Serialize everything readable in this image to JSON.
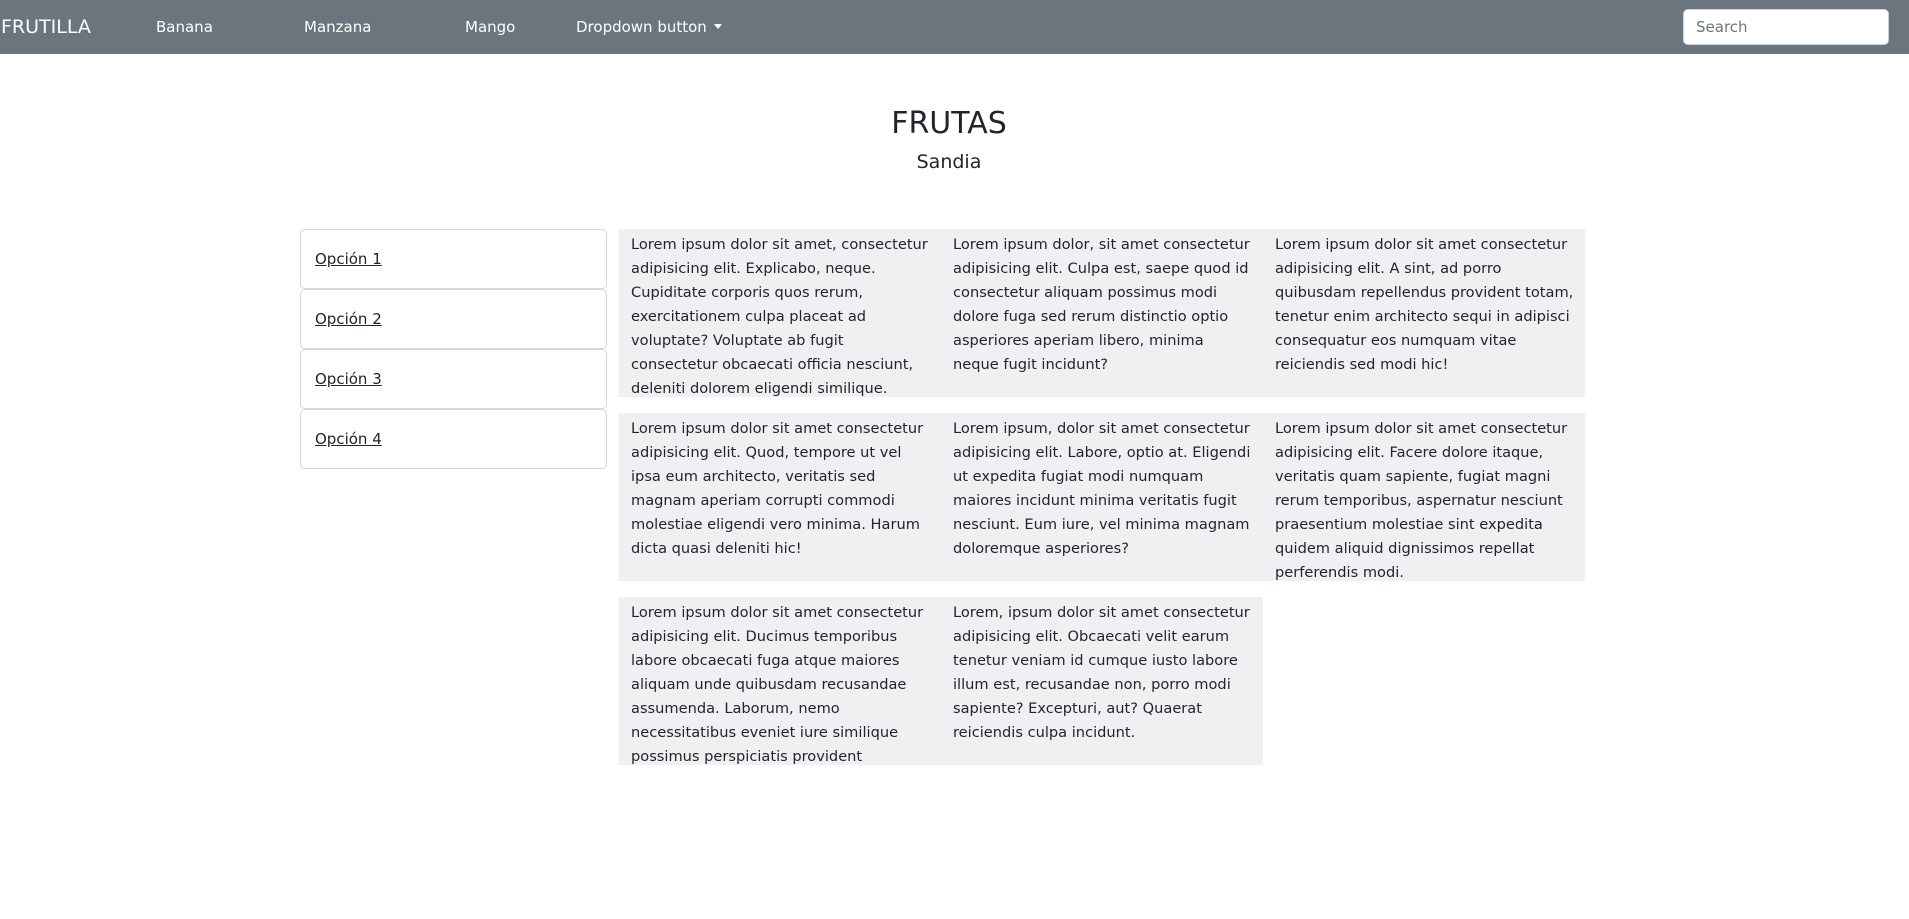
{
  "navbar": {
    "brand": "FRUTILLA",
    "links": [
      "Banana",
      "Manzana",
      "Mango"
    ],
    "dropdown_label": "Dropdown button",
    "search_placeholder": "Search"
  },
  "header": {
    "title": "FRUTAS",
    "subtitle": "Sandia"
  },
  "sidebar": {
    "items": [
      "Opción 1",
      "Opción 2",
      "Opción 3",
      "Opción 4"
    ]
  },
  "grid": {
    "rows": [
      [
        "Lorem ipsum dolor sit amet, consectetur adipisicing elit. Explicabo, neque. Cupiditate corporis quos rerum, exercitationem culpa placeat ad voluptate? Voluptate ab fugit consectetur obcaecati officia nesciunt, deleniti dolorem eligendi similique.",
        "Lorem ipsum dolor, sit amet consectetur adipisicing elit. Culpa est, saepe quod id consectetur aliquam possimus modi dolore fuga sed rerum distinctio optio asperiores aperiam libero, minima neque fugit incidunt?",
        "Lorem ipsum dolor sit amet consectetur adipisicing elit. A sint, ad porro quibusdam repellendus provident totam, tenetur enim architecto sequi in adipisci consequatur eos numquam vitae reiciendis sed modi hic!"
      ],
      [
        "Lorem ipsum dolor sit amet consectetur adipisicing elit. Quod, tempore ut vel ipsa eum architecto, veritatis sed magnam aperiam corrupti commodi molestiae eligendi vero minima. Harum dicta quasi deleniti hic!",
        "Lorem ipsum, dolor sit amet consectetur adipisicing elit. Labore, optio at. Eligendi ut expedita fugiat modi numquam maiores incidunt minima veritatis fugit nesciunt. Eum iure, vel minima magnam doloremque asperiores?",
        "Lorem ipsum dolor sit amet consectetur adipisicing elit. Facere dolore itaque, veritatis quam sapiente, fugiat magni rerum temporibus, aspernatur nesciunt praesentium molestiae sint expedita quidem aliquid dignissimos repellat perferendis modi."
      ],
      [
        "Lorem ipsum dolor sit amet consectetur adipisicing elit. Ducimus temporibus labore obcaecati fuga atque maiores aliquam unde quibusdam recusandae assumenda. Laborum, nemo necessitatibus eveniet iure similique possimus perspiciatis provident excepturi.",
        "Lorem, ipsum dolor sit amet consectetur adipisicing elit. Obcaecati velit earum tenetur veniam id cumque iusto labore illum est, recusandae non, porro modi sapiente? Excepturi, aut? Quaerat reiciendis culpa incidunt."
      ]
    ]
  },
  "colors": {
    "navbar_bg": "#6c757d",
    "grid_bg": "#eff0f2",
    "text": "#212529"
  }
}
